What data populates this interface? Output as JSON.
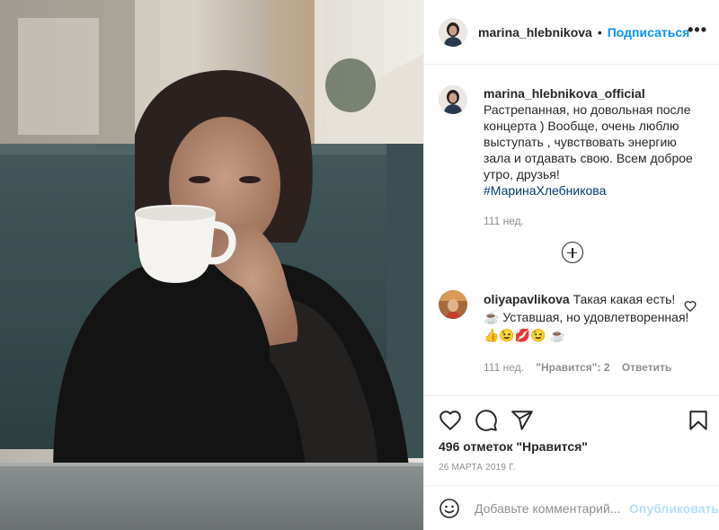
{
  "post": {
    "author": "marina_hlebnikova",
    "separator": "•",
    "follow_label": "Подписаться",
    "more_label": "•••",
    "image_alt": "Photo of a woman in a black sweater drinking from a white cup at a cafe table",
    "like_count_label": "496 отметок \"Нравится\"",
    "date": "26 марта 2019 г."
  },
  "caption": {
    "author": "marina_hlebnikova_official",
    "text": "Растрепанная, но довольная после концерта ) Вообще, очень люблю выступать , чувствовать энергию зала и отдавать свою. Всем доброе утро, друзья!",
    "hashtag": "#МаринаХлебникова",
    "age": "111 нед."
  },
  "comment": {
    "author": "oliyapavlikova",
    "text": "Такая какая есть! ☕ Уставшая, но удовлетворенная! 👍😉💋😉 ☕",
    "age": "111 нед.",
    "likes_label": "\"Нравится\": 2",
    "reply_label": "Ответить"
  },
  "icons": {
    "like": "heart-icon",
    "comment": "comment-bubble-icon",
    "share": "paper-plane-icon",
    "save": "bookmark-icon",
    "emoji": "smiley-icon",
    "load_more": "plus-circle-icon"
  },
  "add_comment": {
    "placeholder": "Добавьте комментарий...",
    "publish_label": "Опубликовать"
  },
  "colors": {
    "link": "#0095f6",
    "hashtag": "#00376b",
    "secondary_text": "#8e8e8e",
    "publish_disabled": "#b2dffc"
  }
}
